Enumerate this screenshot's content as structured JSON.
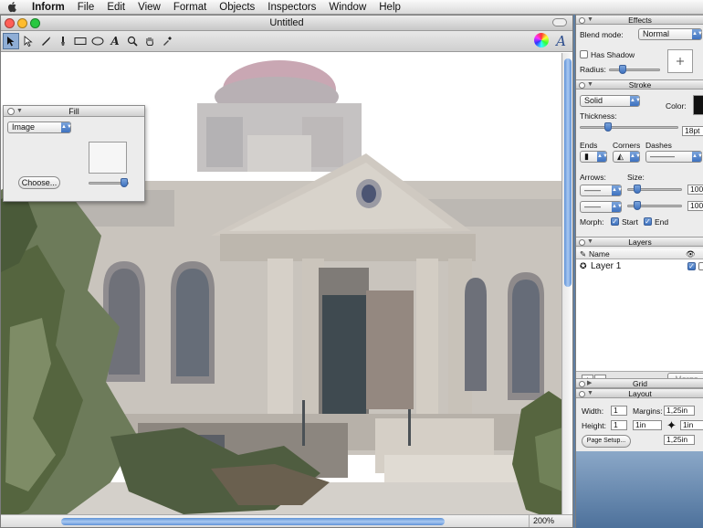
{
  "menubar": {
    "app_name": "Inform",
    "items": [
      "File",
      "Edit",
      "View",
      "Format",
      "Objects",
      "Inspectors",
      "Window",
      "Help"
    ]
  },
  "document": {
    "title": "Untitled",
    "zoom": "200%",
    "tools": [
      "select",
      "direct-select",
      "pen",
      "brush",
      "rectangle",
      "ellipse",
      "text",
      "zoom",
      "hand",
      "eyedropper"
    ]
  },
  "fill_palette": {
    "title": "Fill",
    "type": "Image",
    "choose_button": "Choose..."
  },
  "effects": {
    "title": "Effects",
    "blend_label": "Blend mode:",
    "blend_value": "Normal",
    "shadow_label": "Has Shadow",
    "radius_label": "Radius:"
  },
  "stroke": {
    "title": "Stroke",
    "style": "Solid",
    "color_label": "Color:",
    "thickness_label": "Thickness:",
    "thickness_value": "18pt",
    "ends_label": "Ends",
    "corners_label": "Corners",
    "dashes_label": "Dashes",
    "arrows_label": "Arrows:",
    "size_label": "Size:",
    "size_value_1": "100",
    "size_value_2": "100",
    "morph_label": "Morph:",
    "start_label": "Start",
    "end_label": "End"
  },
  "layers": {
    "title": "Layers",
    "name_header": "Name",
    "items": [
      "Layer 1"
    ],
    "add": "+",
    "remove": "−",
    "merge": "Merge"
  },
  "grid": {
    "title": "Grid"
  },
  "layout": {
    "title": "Layout",
    "width_label": "Width:",
    "width_value": "1",
    "margins_label": "Margins:",
    "margins_value": "1,25in",
    "height_label": "Height:",
    "height_value": "1",
    "margin_2": "1in",
    "margin_3": "1in",
    "margin_4": "1,25in",
    "page_setup": "Page Setup..."
  },
  "colors": {
    "accent": "#3e72c0",
    "selection": "#8faed6",
    "close": "#ff5f57",
    "minimize": "#febc2e",
    "zoom": "#28c840"
  }
}
